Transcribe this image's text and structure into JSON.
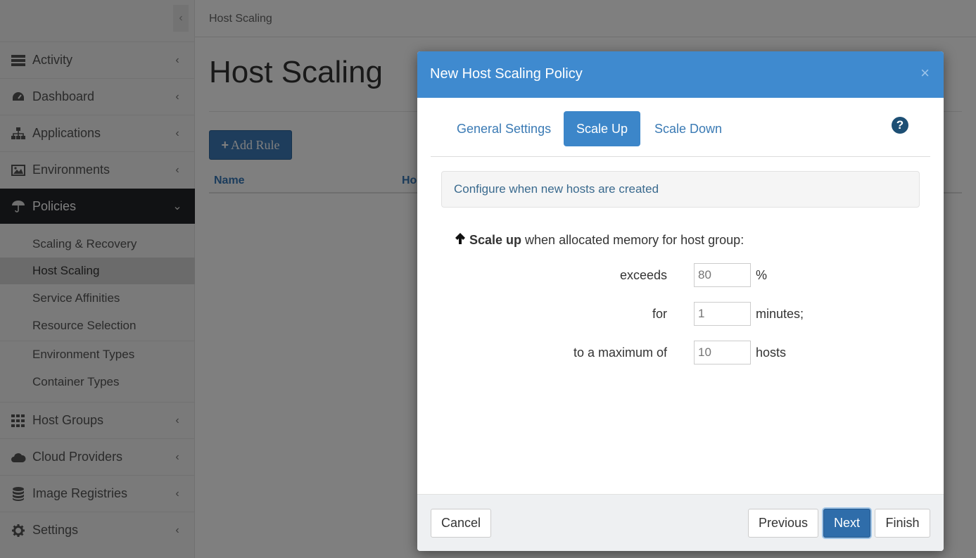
{
  "sidebar": {
    "items": [
      {
        "label": "Activity",
        "icon": "server-icon"
      },
      {
        "label": "Dashboard",
        "icon": "tachometer-icon"
      },
      {
        "label": "Applications",
        "icon": "sitemap-icon"
      },
      {
        "label": "Environments",
        "icon": "image-icon"
      },
      {
        "label": "Policies",
        "icon": "umbrella-icon"
      },
      {
        "label": "Host Groups",
        "icon": "grid-icon"
      },
      {
        "label": "Cloud Providers",
        "icon": "cloud-icon"
      },
      {
        "label": "Image Registries",
        "icon": "database-icon"
      },
      {
        "label": "Settings",
        "icon": "gear-icon"
      }
    ],
    "policies_sub": [
      "Scaling & Recovery",
      "Host Scaling",
      "Service Affinities",
      "Resource Selection",
      "Environment Types",
      "Container Types"
    ]
  },
  "main": {
    "breadcrumb": "Host Scaling",
    "title": "Host Scaling",
    "add_rule_label": "Add Rule",
    "columns": [
      "Name",
      "Ho"
    ]
  },
  "modal": {
    "title": "New Host Scaling Policy",
    "close": "×",
    "tabs": [
      "General Settings",
      "Scale Up",
      "Scale Down"
    ],
    "active_tab": "Scale Up",
    "help": "?",
    "info": "Configure when new hosts are created",
    "scale_bold": "Scale up",
    "scale_rest": "when allocated memory for host group:",
    "rows": [
      {
        "label": "exceeds",
        "placeholder": "80",
        "unit": "%"
      },
      {
        "label": "for",
        "placeholder": "1",
        "unit": "minutes;"
      },
      {
        "label": "to a maximum of",
        "placeholder": "10",
        "unit": "hosts"
      }
    ],
    "buttons": {
      "cancel": "Cancel",
      "previous": "Previous",
      "next": "Next",
      "finish": "Finish"
    }
  },
  "colors": {
    "sidebar_active": "#222429",
    "modal_header": "#3f8acf",
    "primary": "#2f6daa",
    "link": "#3a7ab4"
  }
}
